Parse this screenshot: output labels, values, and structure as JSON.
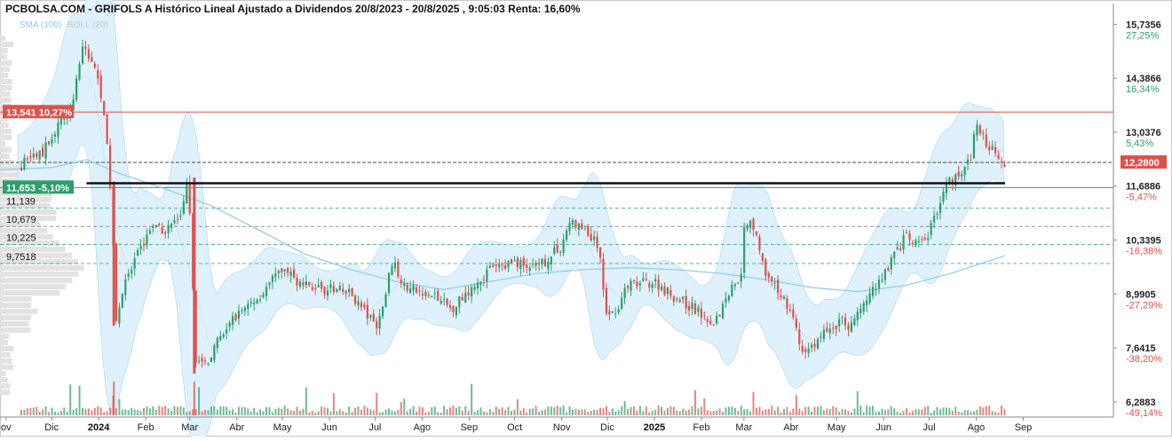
{
  "title": "PCBOLSA.COM - GRIFOLS A Histórico Lineal Ajustado a Dividendos 20/8/2023 - 20/8/2025 , 9:05:03 Renta: 16,60%",
  "legend": {
    "sma": "SMA (100)",
    "boll": "BOLL (20)"
  },
  "colors": {
    "up": "#2e9e6b",
    "down": "#e0504a",
    "sma": "#8ec9ea",
    "boll_fill": "#dff1fc",
    "boll_line": "#b9ddf2",
    "resistance": "#e0504a",
    "support": "#2e9e6b",
    "current": "#e0504a"
  },
  "chart_data": {
    "type": "candlestick",
    "ylim": [
      6.0,
      15.9
    ],
    "x_start": "2023-10-28",
    "x_end": "2025-09-20",
    "price_axis": [
      {
        "value": "15,7356",
        "pct": "27,25%",
        "sign": "pos"
      },
      {
        "value": "14,3866",
        "pct": "16,34%",
        "sign": "pos"
      },
      {
        "value": "13,0376",
        "pct": "5,43%",
        "sign": "pos"
      },
      {
        "value": "11,6886",
        "pct": "-5,47%",
        "sign": "neg"
      },
      {
        "value": "10,3395",
        "pct": "-16,38%",
        "sign": "neg"
      },
      {
        "value": "8,9905",
        "pct": "-27,29%",
        "sign": "neg"
      },
      {
        "value": "7,6415",
        "pct": "-38,20%",
        "sign": "neg"
      },
      {
        "value": "6,2883",
        "pct": "-49,14%",
        "sign": "neg"
      }
    ],
    "current": {
      "value": 12.28,
      "label": "12,2800"
    },
    "resistance": {
      "value": 13.541,
      "label": "13,541",
      "pct": "10,27%"
    },
    "support": {
      "value": 11.653,
      "label": "11,653",
      "pct": "-5,10%"
    },
    "trend_line": {
      "value": 11.76,
      "from": "2023-12-24",
      "to": "2025-08-20"
    },
    "levels": [
      {
        "value": 11.139,
        "label": "11,139"
      },
      {
        "value": 10.679,
        "label": "10,679"
      },
      {
        "value": 10.225,
        "label": "10,225"
      },
      {
        "value": 9.7518,
        "label": "9,7518"
      }
    ],
    "x_ticks": [
      {
        "label": "ov",
        "date": "2023-11-01",
        "bold": false
      },
      {
        "label": "Dic",
        "date": "2023-12-01",
        "bold": false
      },
      {
        "label": "2024",
        "date": "2024-01-01",
        "bold": true
      },
      {
        "label": "Feb",
        "date": "2024-02-01",
        "bold": false
      },
      {
        "label": "Mar",
        "date": "2024-03-01",
        "bold": false
      },
      {
        "label": "Abr",
        "date": "2024-04-01",
        "bold": false
      },
      {
        "label": "May",
        "date": "2024-05-01",
        "bold": false
      },
      {
        "label": "Jun",
        "date": "2024-06-01",
        "bold": false
      },
      {
        "label": "Jul",
        "date": "2024-07-01",
        "bold": false
      },
      {
        "label": "Ago",
        "date": "2024-08-01",
        "bold": false
      },
      {
        "label": "Sep",
        "date": "2024-09-01",
        "bold": false
      },
      {
        "label": "Oct",
        "date": "2024-10-01",
        "bold": false
      },
      {
        "label": "Nov",
        "date": "2024-11-01",
        "bold": false
      },
      {
        "label": "Dic",
        "date": "2024-12-01",
        "bold": false
      },
      {
        "label": "2025",
        "date": "2025-01-01",
        "bold": true
      },
      {
        "label": "Feb",
        "date": "2025-02-01",
        "bold": false
      },
      {
        "label": "Mar",
        "date": "2025-03-01",
        "bold": false
      },
      {
        "label": "Abr",
        "date": "2025-04-01",
        "bold": false
      },
      {
        "label": "May",
        "date": "2025-05-01",
        "bold": false
      },
      {
        "label": "Jun",
        "date": "2025-06-01",
        "bold": false
      },
      {
        "label": "Jul",
        "date": "2025-07-01",
        "bold": false
      },
      {
        "label": "Ago",
        "date": "2025-08-01",
        "bold": false
      },
      {
        "label": "Sep",
        "date": "2025-09-01",
        "bold": false
      }
    ],
    "price_path": [
      [
        "2023-10-28",
        11.0
      ],
      [
        "2023-11-05",
        11.8
      ],
      [
        "2023-11-15",
        12.4
      ],
      [
        "2023-11-25",
        12.5
      ],
      [
        "2023-12-02",
        13.0
      ],
      [
        "2023-12-10",
        13.4
      ],
      [
        "2023-12-16",
        14.0
      ],
      [
        "2023-12-22",
        15.2
      ],
      [
        "2023-12-28",
        14.8
      ],
      [
        "2024-01-04",
        13.8
      ],
      [
        "2024-01-10",
        11.0
      ],
      [
        "2024-01-12",
        8.2
      ],
      [
        "2024-01-16",
        9.0
      ],
      [
        "2024-01-25",
        9.8
      ],
      [
        "2024-02-03",
        10.6
      ],
      [
        "2024-02-15",
        10.6
      ],
      [
        "2024-02-25",
        11.0
      ],
      [
        "2024-02-29",
        11.8
      ],
      [
        "2024-03-02",
        10.0
      ],
      [
        "2024-03-05",
        7.4
      ],
      [
        "2024-03-10",
        7.2
      ],
      [
        "2024-03-20",
        7.8
      ],
      [
        "2024-04-01",
        8.5
      ],
      [
        "2024-04-15",
        8.9
      ],
      [
        "2024-05-01",
        9.6
      ],
      [
        "2024-05-15",
        9.2
      ],
      [
        "2024-06-01",
        9.1
      ],
      [
        "2024-06-15",
        9.0
      ],
      [
        "2024-07-01",
        8.2
      ],
      [
        "2024-07-05",
        8.4
      ],
      [
        "2024-07-12",
        9.8
      ],
      [
        "2024-07-20",
        9.2
      ],
      [
        "2024-08-01",
        9.0
      ],
      [
        "2024-08-10",
        8.9
      ],
      [
        "2024-08-20",
        8.6
      ],
      [
        "2024-09-01",
        9.1
      ],
      [
        "2024-09-15",
        9.6
      ],
      [
        "2024-10-01",
        9.8
      ],
      [
        "2024-10-15",
        9.6
      ],
      [
        "2024-11-01",
        10.2
      ],
      [
        "2024-11-06",
        10.8
      ],
      [
        "2024-11-15",
        10.6
      ],
      [
        "2024-11-25",
        10.2
      ],
      [
        "2024-11-30",
        8.6
      ],
      [
        "2024-12-05",
        8.5
      ],
      [
        "2024-12-15",
        9.2
      ],
      [
        "2025-01-01",
        9.3
      ],
      [
        "2025-01-15",
        8.9
      ],
      [
        "2025-02-01",
        8.5
      ],
      [
        "2025-02-10",
        8.3
      ],
      [
        "2025-02-20",
        9.1
      ],
      [
        "2025-02-27",
        9.5
      ],
      [
        "2025-03-01",
        10.6
      ],
      [
        "2025-03-05",
        10.9
      ],
      [
        "2025-03-10",
        10.4
      ],
      [
        "2025-03-15",
        9.4
      ],
      [
        "2025-03-25",
        9.0
      ],
      [
        "2025-04-01",
        8.6
      ],
      [
        "2025-04-08",
        7.5
      ],
      [
        "2025-04-15",
        7.7
      ],
      [
        "2025-04-25",
        8.1
      ],
      [
        "2025-05-05",
        8.3
      ],
      [
        "2025-05-10",
        8.2
      ],
      [
        "2025-05-20",
        8.8
      ],
      [
        "2025-06-01",
        9.5
      ],
      [
        "2025-06-10",
        10.1
      ],
      [
        "2025-06-15",
        10.4
      ],
      [
        "2025-06-25",
        10.2
      ],
      [
        "2025-07-01",
        10.5
      ],
      [
        "2025-07-05",
        11.0
      ],
      [
        "2025-07-12",
        11.7
      ],
      [
        "2025-07-20",
        12.0
      ],
      [
        "2025-07-28",
        12.3
      ],
      [
        "2025-08-01",
        13.3
      ],
      [
        "2025-08-05",
        12.9
      ],
      [
        "2025-08-12",
        12.6
      ],
      [
        "2025-08-20",
        12.28
      ]
    ],
    "sma_path": [
      [
        "2023-10-28",
        12.1
      ],
      [
        "2023-12-01",
        12.15
      ],
      [
        "2023-12-24",
        12.35
      ],
      [
        "2024-01-15",
        12.0
      ],
      [
        "2024-02-15",
        11.6
      ],
      [
        "2024-03-15",
        11.2
      ],
      [
        "2024-04-15",
        10.6
      ],
      [
        "2024-05-15",
        10.0
      ],
      [
        "2024-06-15",
        9.6
      ],
      [
        "2024-07-15",
        9.3
      ],
      [
        "2024-08-15",
        9.1
      ],
      [
        "2024-09-15",
        9.3
      ],
      [
        "2024-10-15",
        9.5
      ],
      [
        "2024-11-15",
        9.6
      ],
      [
        "2024-12-15",
        9.65
      ],
      [
        "2025-01-15",
        9.6
      ],
      [
        "2025-02-15",
        9.5
      ],
      [
        "2025-03-15",
        9.35
      ],
      [
        "2025-04-15",
        9.15
      ],
      [
        "2025-05-15",
        9.05
      ],
      [
        "2025-06-15",
        9.2
      ],
      [
        "2025-07-15",
        9.5
      ],
      [
        "2025-08-20",
        9.95
      ]
    ]
  }
}
